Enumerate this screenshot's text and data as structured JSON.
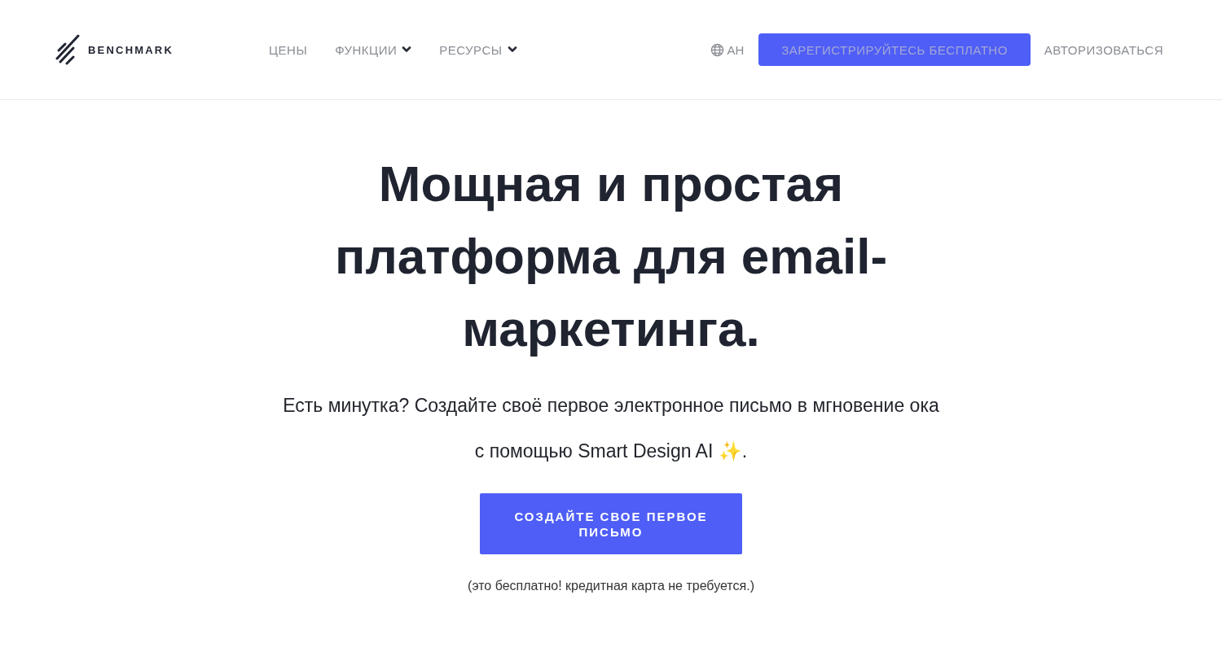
{
  "header": {
    "logo": "BENCHMARK",
    "nav": [
      {
        "label": "ЦЕНЫ",
        "has_menu": false
      },
      {
        "label": "ФУНКЦИИ",
        "has_menu": true
      },
      {
        "label": "РЕСУРСЫ",
        "has_menu": true
      }
    ],
    "language": "АН",
    "signup_button": "ЗАРЕГИСТРИРУЙТЕСЬ БЕСПЛАТНО",
    "login_link": "АВТОРИЗОВАТЬСЯ"
  },
  "hero": {
    "title": "Мощная и простая платформа для email-маркетинга.",
    "subtitle_lines": [
      "Есть минутка? Создайте своё первое электронное письмо в мгновение ока",
      "с помощью Smart Design AI ✨."
    ],
    "cta_button": "СОЗДАЙТЕ СВОЕ ПЕРВОЕ ПИСЬМО",
    "note": "(это бесплатно! кредитная карта не требуется.)"
  }
}
